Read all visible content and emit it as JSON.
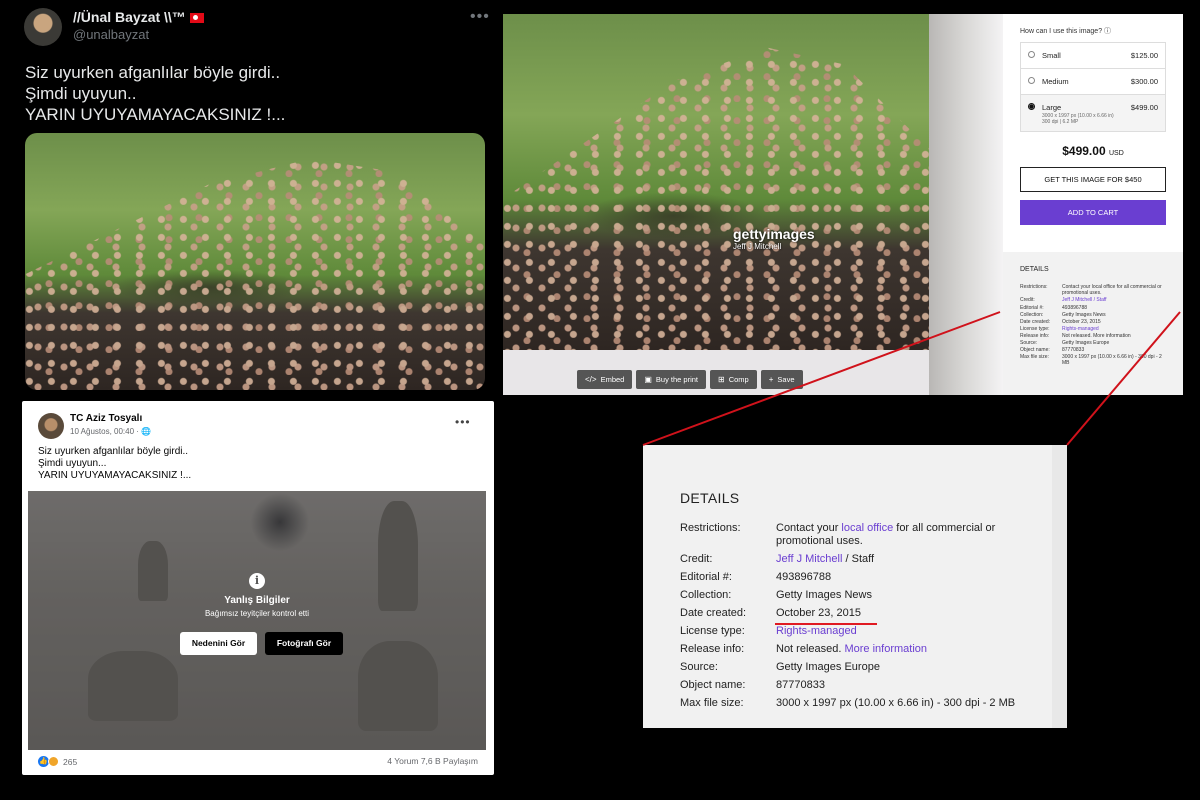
{
  "tweet": {
    "name": "//Ünal Bayzat \\\\™",
    "handle": "@unalbayzat",
    "more": "•••",
    "lines": [
      "Siz uyurken afganlılar böyle girdi..",
      "Şimdi uyuyun..",
      "YARIN UYUYAMAYACAKSINIZ !..."
    ]
  },
  "getty": {
    "watermark": "gettyimages",
    "watermark_credit": "Jeff J Mitchell",
    "toolbar": [
      {
        "icon": "</>",
        "label": "Embed"
      },
      {
        "icon": "▣",
        "label": "Buy the print"
      },
      {
        "icon": "⊞",
        "label": "Comp"
      },
      {
        "icon": "+",
        "label": "Save"
      }
    ],
    "question": "How can I use this image? ⓘ",
    "sizes": [
      {
        "name": "Small",
        "price": "$125.00",
        "selected": false
      },
      {
        "name": "Medium",
        "price": "$300.00",
        "selected": false
      },
      {
        "name": "Large",
        "price": "$499.00",
        "selected": true,
        "dims_1": "3000 x 1997 px (10.00 x 6.66 in)",
        "dims_2": "300 dpi | 6.2 MP"
      }
    ],
    "total": "$499.00",
    "total_currency": "USD",
    "get_button": "GET THIS IMAGE FOR $450",
    "cart_button": "ADD TO CART",
    "details_title": "DETAILS",
    "details": [
      {
        "k": "Restrictions:",
        "v": "Contact your local office for all commercial or promotional uses."
      },
      {
        "k": "Credit:",
        "v": "Jeff J Mitchell / Staff"
      },
      {
        "k": "Editorial #:",
        "v": "493896788"
      },
      {
        "k": "Collection:",
        "v": "Getty Images News"
      },
      {
        "k": "Date created:",
        "v": "October 23, 2015"
      },
      {
        "k": "License type:",
        "v": "Rights-managed"
      },
      {
        "k": "Release info:",
        "v": "Not released. More information"
      },
      {
        "k": "Source:",
        "v": "Getty Images Europe"
      },
      {
        "k": "Object name:",
        "v": "87770833"
      },
      {
        "k": "Max file size:",
        "v": "3000 x 1997 px (10.00 x 6.66 in) - 300 dpi - 2 MB"
      }
    ]
  },
  "fb": {
    "name": "TC Aziz Tosyalı",
    "date": "10 Ağustos, 00:40 · 🌐",
    "more": "•••",
    "lines": [
      "Siz uyurken afganlılar böyle girdi..",
      "Şimdi uyuyun...",
      "YARIN UYUYAMAYACAKSINIZ !..."
    ],
    "info_icon": "i",
    "factcheck_title": "Yanlış Bilgiler",
    "factcheck_sub": "Bağımsız teyitçiler kontrol etti",
    "why_button": "Nedenini Gör",
    "see_photo_button": "Fotoğrafı Gör",
    "reaction_count": "265",
    "like_glyph": "👍",
    "comments_shares": "4 Yorum  7,6 B Paylaşım"
  },
  "zoom": {
    "title": "DETAILS",
    "restrictions_key": "Restrictions:",
    "restrictions_pre": "Contact your ",
    "restrictions_link": "local office",
    "restrictions_post": " for all commercial or promotional uses.",
    "credit_key": "Credit:",
    "credit_link": "Jeff J Mitchell",
    "credit_post": " / Staff",
    "editorial_key": "Editorial #:",
    "editorial_val": "493896788",
    "collection_key": "Collection:",
    "collection_val": "Getty Images News",
    "date_key": "Date created:",
    "date_val": "October 23, 2015",
    "license_key": "License type:",
    "license_link": "Rights-managed",
    "release_key": "Release info:",
    "release_pre": "Not released. ",
    "release_link": "More information",
    "source_key": "Source:",
    "source_val": "Getty Images Europe",
    "object_key": "Object name:",
    "object_val": "87770833",
    "maxsize_key": "Max file size:",
    "maxsize_val": "3000 x 1997 px (10.00 x 6.66 in) - 300 dpi - 2 MB"
  },
  "colors": {
    "accent_purple": "#6a3ed1",
    "highlight_red": "#e01a22",
    "facebook_blue": "#1877f2"
  }
}
